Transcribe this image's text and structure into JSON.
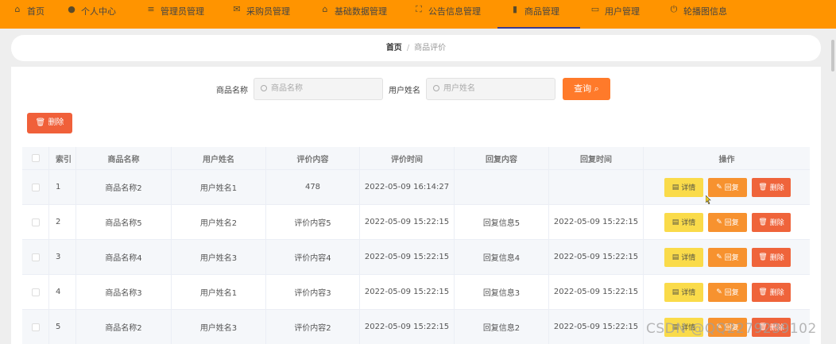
{
  "nav": [
    {
      "icon": "home-icon",
      "glyph": "⌂",
      "label": "首页"
    },
    {
      "icon": "user-icon",
      "glyph": "●",
      "label": "个人中心"
    },
    {
      "icon": "list-icon",
      "glyph": "≡",
      "label": "管理员管理"
    },
    {
      "icon": "mail-icon",
      "glyph": "✉",
      "label": "采购员管理"
    },
    {
      "icon": "lock-icon",
      "glyph": "⌂",
      "label": "基础数据管理"
    },
    {
      "icon": "fullscreen-icon",
      "glyph": "⛶",
      "label": "公告信息管理"
    },
    {
      "icon": "chart-icon",
      "glyph": "▮",
      "label": "商品管理",
      "active": true
    },
    {
      "icon": "monitor-icon",
      "glyph": "▭",
      "label": "用户管理"
    },
    {
      "icon": "power-icon",
      "glyph": "⏻",
      "label": "轮播图信息"
    }
  ],
  "breadcrumb": {
    "home": "首页",
    "current": "商品评价"
  },
  "search": {
    "product_label": "商品名称",
    "product_placeholder": "商品名称",
    "user_label": "用户姓名",
    "user_placeholder": "用户姓名",
    "query_label": "查询"
  },
  "delete_label": "删除",
  "table": {
    "headers": [
      "索引",
      "商品名称",
      "用户姓名",
      "评价内容",
      "评价时间",
      "回复内容",
      "回复时间",
      "操作"
    ],
    "rows": [
      {
        "index": "1",
        "product": "商品名称2",
        "user": "用户姓名1",
        "content": "478",
        "time": "2022-05-09 16:14:27",
        "reply": "",
        "reply_time": ""
      },
      {
        "index": "2",
        "product": "商品名称5",
        "user": "用户姓名2",
        "content": "评价内容5",
        "time": "2022-05-09 15:22:15",
        "reply": "回复信息5",
        "reply_time": "2022-05-09 15:22:15"
      },
      {
        "index": "3",
        "product": "商品名称4",
        "user": "用户姓名3",
        "content": "评价内容4",
        "time": "2022-05-09 15:22:15",
        "reply": "回复信息4",
        "reply_time": "2022-05-09 15:22:15"
      },
      {
        "index": "4",
        "product": "商品名称3",
        "user": "用户姓名1",
        "content": "评价内容3",
        "time": "2022-05-09 15:22:15",
        "reply": "回复信息3",
        "reply_time": "2022-05-09 15:22:15"
      },
      {
        "index": "5",
        "product": "商品名称2",
        "user": "用户姓名3",
        "content": "评价内容2",
        "time": "2022-05-09 15:22:15",
        "reply": "回复信息2",
        "reply_time": "2022-05-09 15:22:15"
      }
    ],
    "actions": {
      "detail": "详情",
      "reply": "回复",
      "delete": "删除"
    }
  },
  "watermark": "CSDN @QQ2279239102",
  "colors": {
    "nav_bg": "#ff9400",
    "query": "#ff7a2a",
    "delete": "#ef643b",
    "detail": "#fadb4a",
    "reply": "#f7922f"
  }
}
